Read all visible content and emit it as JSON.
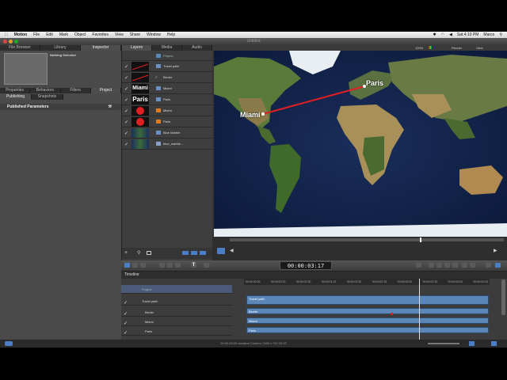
{
  "menubar": {
    "app": "Motion",
    "items": [
      "File",
      "Edit",
      "Mark",
      "Object",
      "Favorites",
      "View",
      "Share",
      "Window",
      "Help"
    ],
    "clock": "Sat 4:10 PM",
    "user": "Marco"
  },
  "window": {
    "title": "Untitled"
  },
  "left_panel": {
    "tabs": [
      "File Browser",
      "Library",
      "Inspector"
    ],
    "nothing_selected": "Nothing Selected",
    "sub_tabs": [
      "Properties",
      "Behaviors",
      "Filters",
      "Project"
    ],
    "sub_sub_tabs": [
      "Publishing",
      "Snapshots"
    ],
    "published_params": "Published Parameters"
  },
  "middle_panel": {
    "tabs": [
      "Layers",
      "Media",
      "Audio"
    ],
    "project_row": "Project",
    "layers": [
      {
        "name": "Travel path"
      },
      {
        "name": "Bezier"
      },
      {
        "name": "Miami"
      },
      {
        "name": "Paris"
      },
      {
        "name": "Miami"
      },
      {
        "name": "Paris"
      },
      {
        "name": "Blue Marble"
      },
      {
        "name": "blue_marble..."
      }
    ],
    "thumb_text": {
      "miami": "Miami",
      "paris": "Paris"
    }
  },
  "canvas": {
    "zoom": "100%",
    "render": "Render",
    "view": "View",
    "labels": {
      "paris": "Paris",
      "miami": "Miami"
    }
  },
  "transport": {
    "timecode": "00:00:03:17"
  },
  "timeline": {
    "title": "Timeline",
    "rows": [
      "Project",
      "Travel path",
      "Bezier",
      "Miami",
      "Paris"
    ],
    "ruler": [
      "00:00:00:00",
      "00:00:00:15",
      "00:00:01:00",
      "00:00:01:15",
      "00:00:02:00",
      "00:00:02:15",
      "00:00:03:00",
      "00:00:03:15",
      "00:00:04:00",
      "00:00:04:15"
    ],
    "bars": [
      "Travel path",
      "Bezier",
      "Miami",
      "Paris"
    ]
  },
  "statusbar": {
    "text": "00:00:05:00 duration Custom 1280 x 720 29.97"
  },
  "colors": {
    "accent": "#4a7fc8",
    "path": "#e02020",
    "timeline_bar": "#5b86b8"
  }
}
